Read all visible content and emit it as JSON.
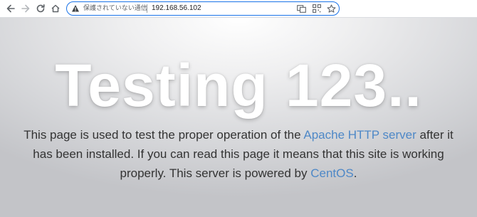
{
  "browser": {
    "security_label": "保護されていない通信",
    "url": "192.168.56.102",
    "icons": [
      "back-arrow-icon",
      "forward-arrow-icon",
      "reload-icon",
      "home-icon",
      "warning-icon",
      "translate-icon",
      "qr-code-icon",
      "star-icon"
    ]
  },
  "page": {
    "title": "Testing 123..",
    "lead": {
      "part1": "This page is used to test the proper operation of the ",
      "apache_link": "Apache HTTP server",
      "part2": " after it has been installed. If you can read this page it means that this site is working properly. This server is powered by ",
      "centos_link": "CentOS",
      "part3": "."
    },
    "colors": {
      "link": "#4e88c7",
      "text": "#333333",
      "title": "#ffffff"
    }
  }
}
